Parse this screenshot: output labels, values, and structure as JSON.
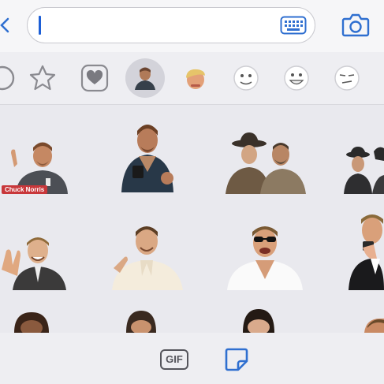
{
  "composer": {
    "input_value": "",
    "keyboard_icon": "keyboard-icon",
    "camera_icon": "camera-icon",
    "back_icon": "chevron-left-icon"
  },
  "sticker_tabs": [
    {
      "name": "recent",
      "icon": "clock-icon"
    },
    {
      "name": "favorites",
      "icon": "star-icon"
    },
    {
      "name": "love",
      "icon": "heart-icon"
    },
    {
      "name": "chuck-norris-pack",
      "icon": "avatar",
      "selected": true
    },
    {
      "name": "trump-pack",
      "icon": "avatar"
    },
    {
      "name": "meme-pack-1",
      "icon": "rage-face"
    },
    {
      "name": "meme-pack-2",
      "icon": "rage-face"
    },
    {
      "name": "meme-pack-3",
      "icon": "rage-face"
    }
  ],
  "stickers": [
    {
      "row": 1,
      "caption": "Chuck Norris"
    },
    {
      "row": 1,
      "caption": ""
    },
    {
      "row": 1,
      "caption": ""
    },
    {
      "row": 1,
      "caption": ""
    },
    {
      "row": 2,
      "caption": ""
    },
    {
      "row": 2,
      "caption": ""
    },
    {
      "row": 2,
      "caption": ""
    },
    {
      "row": 2,
      "caption": ""
    },
    {
      "row": 3,
      "caption": ""
    },
    {
      "row": 3,
      "caption": ""
    },
    {
      "row": 3,
      "caption": ""
    },
    {
      "row": 3,
      "caption": ""
    }
  ],
  "bottom_bar": {
    "gif_label": "GIF",
    "sticker_icon": "sticker-icon"
  },
  "colors": {
    "accent": "#2f6fd0",
    "caret": "#1d5fd6",
    "panel_bg": "#e9e9ee",
    "caption_bg": "#c8373a"
  }
}
